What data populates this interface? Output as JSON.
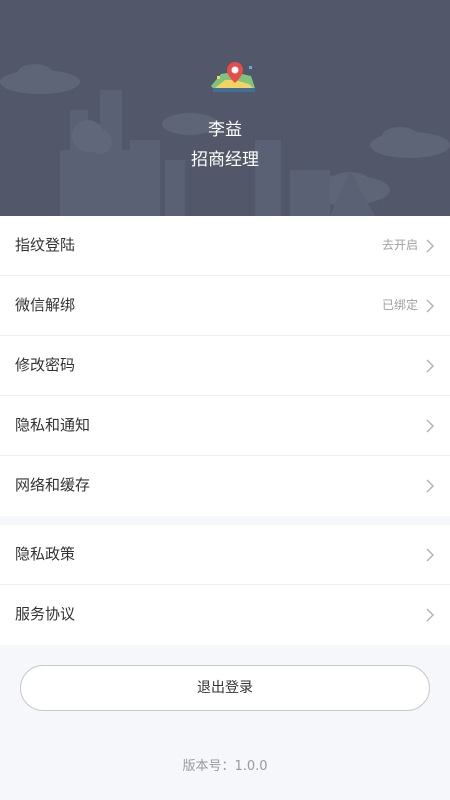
{
  "profile": {
    "name": "李益",
    "title": "招商经理"
  },
  "settings_group_1": [
    {
      "label": "指纹登陆",
      "status": "去开启"
    },
    {
      "label": "微信解绑",
      "status": "已绑定"
    },
    {
      "label": "修改密码",
      "status": ""
    },
    {
      "label": "隐私和通知",
      "status": ""
    },
    {
      "label": "网络和缓存",
      "status": ""
    }
  ],
  "settings_group_2": [
    {
      "label": "隐私政策",
      "status": ""
    },
    {
      "label": "服务协议",
      "status": ""
    }
  ],
  "logout": {
    "label": "退出登录"
  },
  "version": {
    "label": "版本号：",
    "value": "1.0.0"
  },
  "icons": {
    "menu_arrow": "chevron-right-icon",
    "logo": "map-pin-icon"
  },
  "colors": {
    "header_bg": "#52586a",
    "page_bg": "#f6f7fb",
    "card_bg": "#ffffff",
    "status_text": "#a0a0a0"
  }
}
